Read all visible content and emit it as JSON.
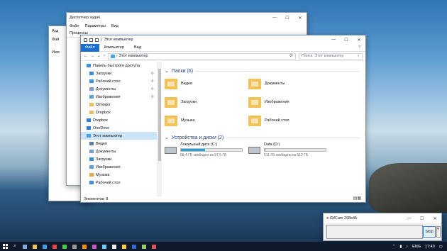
{
  "taskmgr": {
    "title": "Диспетчер задач",
    "menu": [
      "Файл",
      "Параметры",
      "Вид"
    ],
    "tab": "Процессы"
  },
  "back_window": {
    "title": "Ауд",
    "menu": "Фай",
    "col": "Имя"
  },
  "explorer": {
    "title": "Этот компьютер",
    "ribbon": [
      "Файл",
      "Компьютер",
      "Вид"
    ],
    "address": "Этот компьютер",
    "search_placeholder": "Поиск: Этот компьютер",
    "nav": [
      {
        "label": "Панель быстрого доступа",
        "icon": "star-icon"
      },
      {
        "label": "Загрузки",
        "icon": "download-icon",
        "pin": true
      },
      {
        "label": "Рабочий стол",
        "icon": "desktop-icon",
        "pin": true
      },
      {
        "label": "Документы",
        "icon": "documents-icon",
        "pin": true
      },
      {
        "label": "Изображения",
        "icon": "pictures-icon",
        "pin": true
      },
      {
        "label": "Dimogor",
        "icon": "folder-icon"
      },
      {
        "label": "Dropbox",
        "icon": "folder-icon"
      },
      {
        "label": "Dropbox",
        "icon": "dropbox-icon"
      },
      {
        "label": "OneDrive",
        "icon": "onedrive-icon"
      },
      {
        "label": "Этот компьютер",
        "icon": "computer-icon",
        "selected": true
      },
      {
        "label": "Видео",
        "icon": "video-icon"
      },
      {
        "label": "Документы",
        "icon": "documents-icon"
      },
      {
        "label": "Загрузки",
        "icon": "download-icon"
      },
      {
        "label": "Изображения",
        "icon": "pictures-icon"
      },
      {
        "label": "Музыка",
        "icon": "music-icon"
      },
      {
        "label": "Рабочий стол",
        "icon": "desktop-icon"
      }
    ],
    "folders_header": "Папки (6)",
    "folders": [
      "Видео",
      "Документы",
      "Загрузки",
      "Изображения",
      "Музыка",
      "Рабочий стол"
    ],
    "drives_header": "Устройства и диски (2)",
    "drives": [
      {
        "name": "Локальный диск (C:)",
        "free": "58,4 ГБ свободно из 97,5 ГБ",
        "used_fraction": 0.4
      },
      {
        "name": "Data (D:)",
        "free": "511 ГБ свободно из 512 ГБ",
        "used_fraction": 0.01
      }
    ],
    "status": "Элементов: 8"
  },
  "gifcam": {
    "title": "GifCam 298x45",
    "stop": "Stop"
  },
  "taskbar": {
    "lang": "ENG",
    "time": "17:40"
  }
}
